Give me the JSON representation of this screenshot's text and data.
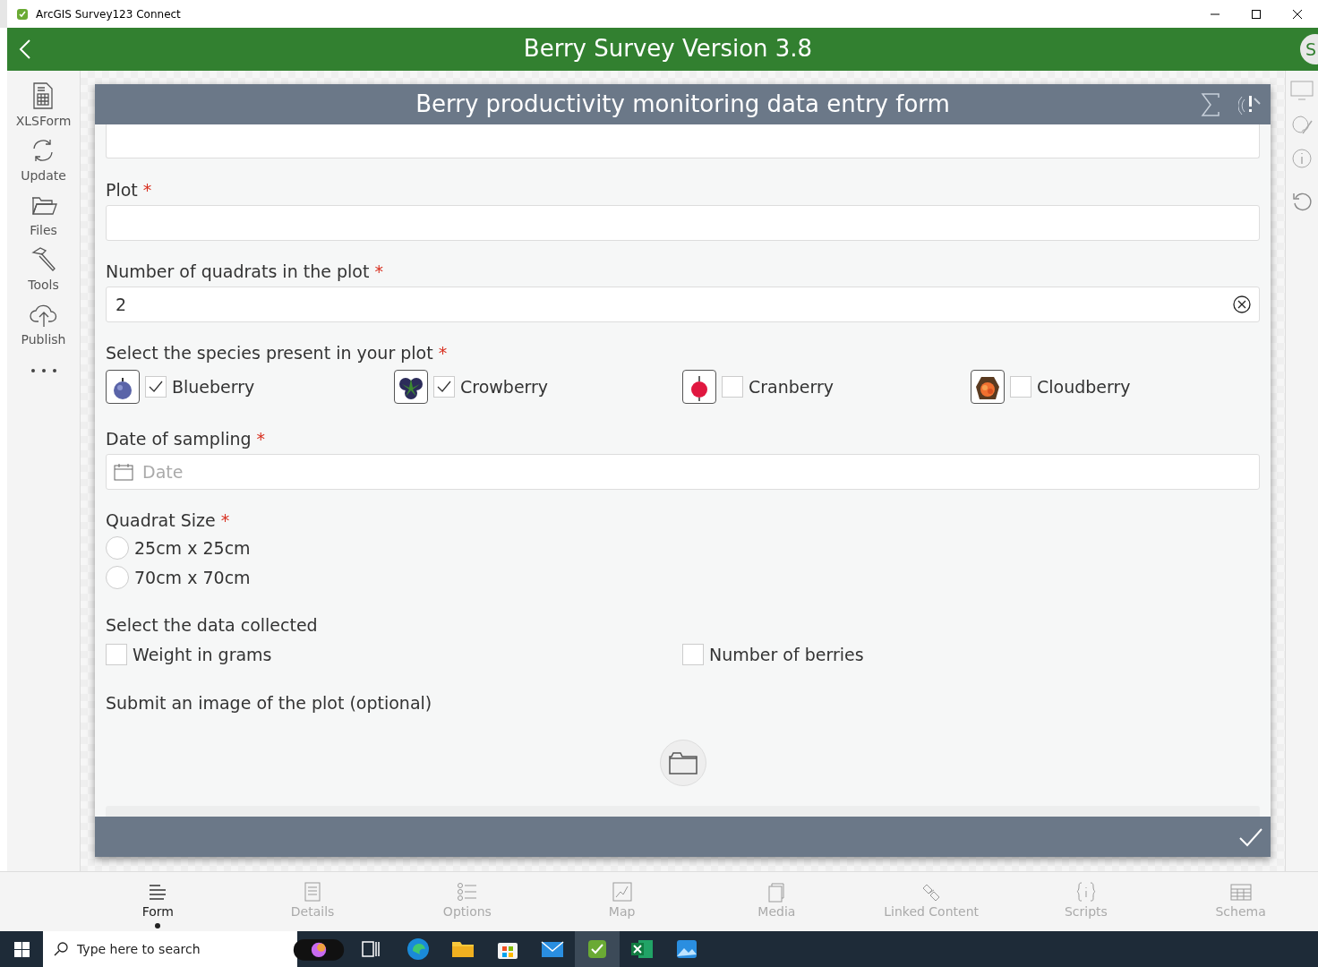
{
  "window": {
    "title": "ArcGIS Survey123 Connect"
  },
  "app_bar": {
    "title": "Berry Survey Version 3.8",
    "avatar": "S"
  },
  "sidebar": {
    "items": [
      {
        "label": "XLSForm",
        "kind": "xlsform"
      },
      {
        "label": "Update",
        "kind": "update"
      },
      {
        "label": "Files",
        "kind": "files"
      },
      {
        "label": "Tools",
        "kind": "tools"
      },
      {
        "label": "Publish",
        "kind": "publish"
      }
    ]
  },
  "form": {
    "title": "Berry productivity monitoring data entry form",
    "questions": [
      {
        "kind": "partial"
      },
      {
        "kind": "text",
        "label": "Plot",
        "required_mark": "*"
      },
      {
        "kind": "text",
        "label": "Number of quadrats in the plot",
        "required_mark": "*",
        "value": "2"
      },
      {
        "kind": "multi_image",
        "label": "Select the species present in your plot",
        "required_mark": "*",
        "options": [
          {
            "label": "Blueberry",
            "checked": true,
            "kind": "blueberry"
          },
          {
            "label": "Crowberry",
            "checked": true,
            "kind": "crowberry"
          },
          {
            "label": "Cranberry",
            "checked": false,
            "kind": "cranberry"
          },
          {
            "label": "Cloudberry",
            "checked": false,
            "kind": "cloudberry"
          }
        ]
      },
      {
        "kind": "date",
        "label": "Date of sampling",
        "required_mark": "*",
        "placeholder": "Date"
      },
      {
        "kind": "single",
        "label": "Quadrat Size",
        "required_mark": "*",
        "options": [
          {
            "label": "25cm x 25cm",
            "selected": false
          },
          {
            "label": "70cm x 70cm",
            "selected": false
          }
        ]
      },
      {
        "kind": "multi",
        "label": "Select the data collected",
        "options": [
          {
            "label": "Weight in grams",
            "checked": false
          },
          {
            "label": "Number of berries",
            "checked": false
          }
        ]
      },
      {
        "label": "Submit an image of the plot (optional)"
      },
      {
        "kind": "group"
      }
    ]
  },
  "bottom_tabs": [
    {
      "label": "Form",
      "selected": true,
      "kind": "form"
    },
    {
      "label": "Details",
      "selected": false,
      "kind": "details"
    },
    {
      "label": "Options",
      "selected": false,
      "kind": "options"
    },
    {
      "label": "Map",
      "selected": false,
      "kind": "map"
    },
    {
      "label": "Media",
      "selected": false,
      "kind": "media"
    },
    {
      "label": "Linked Content",
      "selected": false,
      "kind": "link"
    },
    {
      "label": "Scripts",
      "selected": false,
      "kind": "scripts"
    },
    {
      "label": "Schema",
      "selected": false,
      "kind": "schema"
    }
  ],
  "taskbar": {
    "search_placeholder": "Type here to search"
  }
}
